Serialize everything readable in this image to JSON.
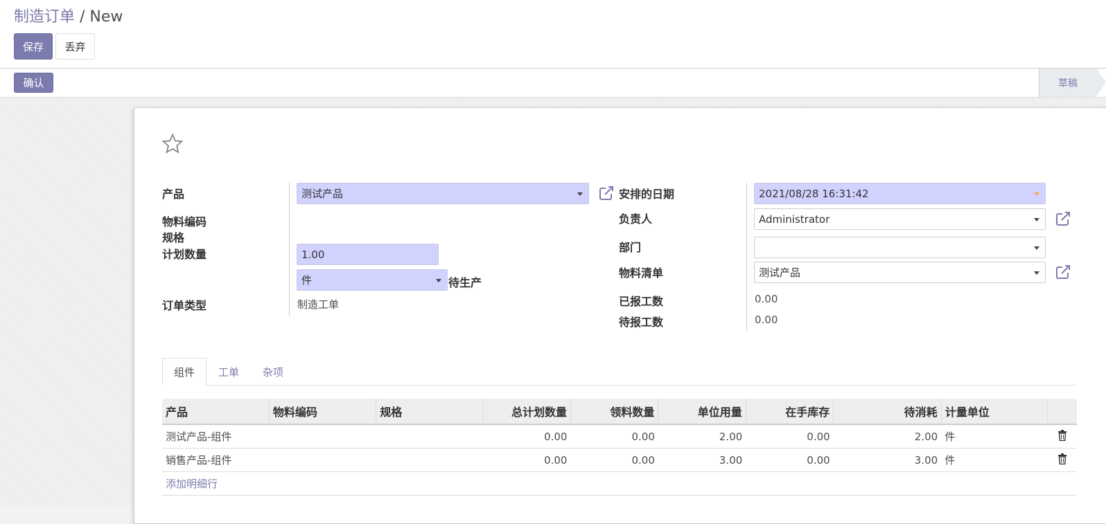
{
  "breadcrumb": {
    "parent": "制造订单",
    "separator": " / ",
    "current": "New"
  },
  "buttons": {
    "save": "保存",
    "discard": "丢弃",
    "confirm": "确认"
  },
  "status": {
    "draft": "草稿"
  },
  "form": {
    "labels": {
      "product": "产品",
      "material_code": "物料编码",
      "spec": "规格",
      "planned_qty": "计划数量",
      "order_type": "订单类型",
      "scheduled_date": "安排的日期",
      "responsible": "负责人",
      "department": "部门",
      "bom": "物料清单",
      "reported_hours": "已报工数",
      "pending_hours": "待报工数"
    },
    "product": "测试产品",
    "planned_qty": "1.00",
    "uom": "件",
    "qty_status": "待生产",
    "order_type": "制造工单",
    "scheduled_date": "2021/08/28 16:31:42",
    "responsible": "Administrator",
    "department": "",
    "bom": "测试产品",
    "reported_hours": "0.00",
    "pending_hours": "0.00"
  },
  "tabs": [
    "组件",
    "工单",
    "杂项"
  ],
  "table": {
    "headers": [
      "产品",
      "物料编码",
      "规格",
      "总计划数量",
      "领料数量",
      "单位用量",
      "在手库存",
      "待消耗",
      "计量单位",
      ""
    ],
    "rows": [
      [
        "测试产品-组件",
        "",
        "",
        "0.00",
        "0.00",
        "2.00",
        "0.00",
        "2.00",
        "件"
      ],
      [
        "销售产品-组件",
        "",
        "",
        "0.00",
        "0.00",
        "3.00",
        "0.00",
        "3.00",
        "件"
      ]
    ],
    "add_line": "添加明细行"
  },
  "colors": {
    "brand": "#7c7bad",
    "required_field": "#d2d2ff",
    "annotation_arrow": "#e02020"
  }
}
